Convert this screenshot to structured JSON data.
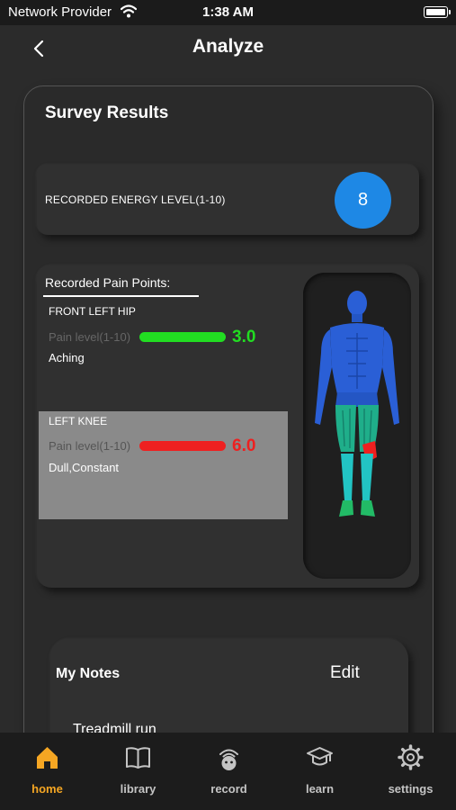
{
  "status_bar": {
    "carrier": "Network Provider",
    "time": "1:38 AM"
  },
  "nav": {
    "title": "Analyze"
  },
  "survey": {
    "title": "Survey Results",
    "energy_label": "RECORDED ENERGY LEVEL(1-10)",
    "energy_value": "8",
    "pain_header": "Recorded Pain Points:",
    "pain_points": [
      {
        "location": "FRONT LEFT HIP",
        "level_label": "Pain level(1-10)",
        "value": "3.0",
        "level": 3.0,
        "description": "Aching",
        "color": "#22dd22"
      },
      {
        "location": "LEFT KNEE",
        "level_label": "Pain level(1-10)",
        "value": "6.0",
        "level": 6.0,
        "description": "Dull,Constant",
        "color": "#ee2020"
      }
    ]
  },
  "notes": {
    "title": "My Notes",
    "edit_label": "Edit",
    "items": [
      "Treadmill run"
    ]
  },
  "tabs": [
    {
      "label": "home",
      "icon": "home-icon",
      "active": true
    },
    {
      "label": "library",
      "icon": "book-icon",
      "active": false
    },
    {
      "label": "record",
      "icon": "record-icon",
      "active": false
    },
    {
      "label": "learn",
      "icon": "graduation-cap-icon",
      "active": false
    },
    {
      "label": "settings",
      "icon": "gear-icon",
      "active": false
    }
  ],
  "colors": {
    "accent": "#f5a623",
    "energy_badge": "#1e88e5",
    "body_figure": "#2a5fd6"
  }
}
